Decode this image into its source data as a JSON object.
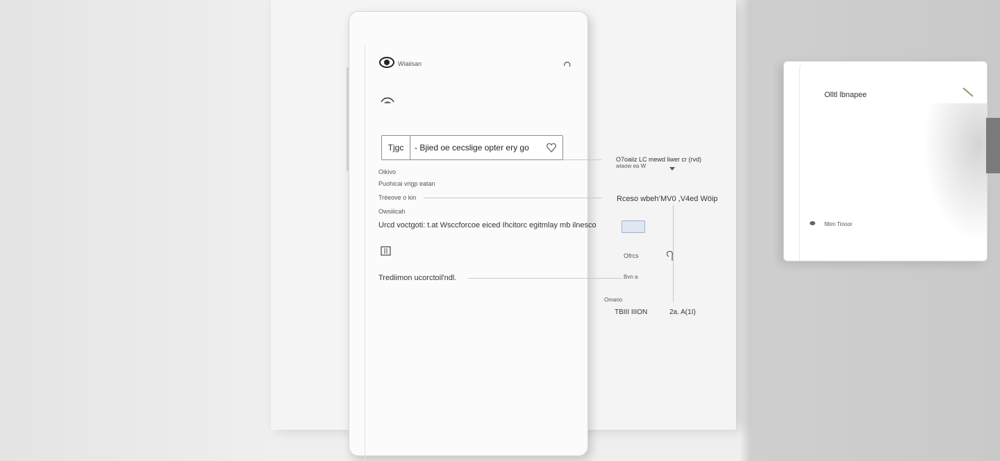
{
  "phone": {
    "header_logo": "Wiaiisan",
    "search": {
      "tag": "Tjgc",
      "value": "- Bjied oе cecslige opter  ery go"
    },
    "list": {
      "section1": "Oikivo",
      "row1": "Puohicai  vrigp eatan",
      "row2": "Tréeove o  kin",
      "section2": "Owsiiicah",
      "description": "Urcd voctgoti: t.at Wsccforcoe eiced  Ihcitorc egitmlay  mb  ilnesco",
      "row3": "Trediimon  ucorctoil'ndl."
    }
  },
  "callouts": {
    "top": "O7oaiiz  LC  mewd  liwer cr (rvd)",
    "top_sub": "wiaow ea  W",
    "mid": "Rceso  wbeh’MV0 ,V4ed  Wöip",
    "toggle_caption": "Ofrcs",
    "toggle_sub": "Bvn a",
    "bottom_small": "Omano",
    "bottom_left": "TBIII  IIION",
    "bottom_right": "2a.    A(1I)"
  },
  "card": {
    "title": "Olltl lbnapee",
    "footer": "fillim  Tinoor"
  },
  "colors": {
    "accent": "#dfe7f4",
    "accent_border": "#9fb0cc"
  }
}
